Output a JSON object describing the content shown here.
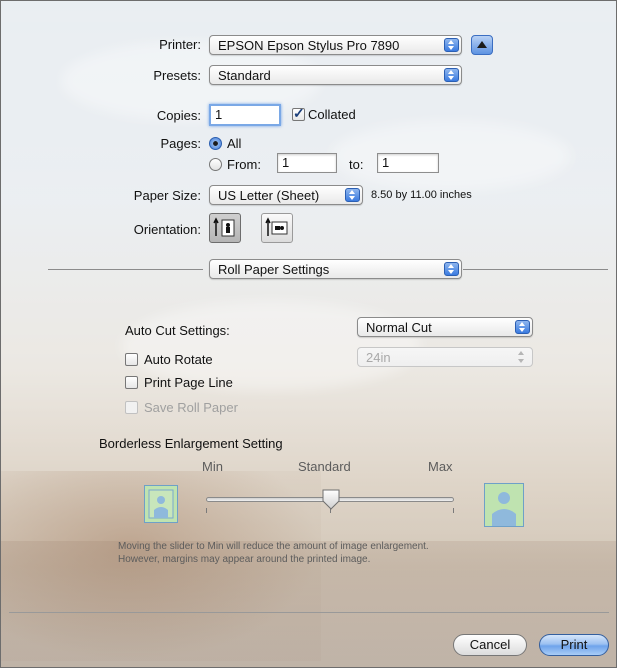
{
  "printer": {
    "label": "Printer:",
    "value": "EPSON Epson Stylus Pro 7890"
  },
  "presets": {
    "label": "Presets:",
    "value": "Standard"
  },
  "copies": {
    "label": "Copies:",
    "value": "1",
    "collated_label": "Collated",
    "collated": true
  },
  "pages": {
    "label": "Pages:",
    "all_label": "All",
    "from_label": "From:",
    "from_value": "1",
    "to_label": "to:",
    "to_value": "1",
    "selected": "All"
  },
  "paper_size": {
    "label": "Paper Size:",
    "value": "US Letter (Sheet)",
    "dimensions": "8.50 by 11.00 inches"
  },
  "orientation": {
    "label": "Orientation:",
    "selected": "portrait"
  },
  "panel_select": {
    "value": "Roll Paper Settings"
  },
  "auto_cut": {
    "label": "Auto Cut Settings:",
    "value": "Normal Cut"
  },
  "options": {
    "auto_rotate": {
      "label": "Auto Rotate",
      "checked": false,
      "enabled": true
    },
    "print_page_line": {
      "label": "Print Page Line",
      "checked": false,
      "enabled": true
    },
    "save_roll_paper": {
      "label": "Save Roll Paper",
      "checked": false,
      "enabled": false
    }
  },
  "roll_width": {
    "value": "24in",
    "enabled": false
  },
  "borderless": {
    "title": "Borderless Enlargement Setting",
    "min_label": "Min",
    "standard_label": "Standard",
    "max_label": "Max",
    "slider_position": "Standard",
    "note_line1": "Moving the slider to Min will reduce the amount of image enlargement.",
    "note_line2": "However, margins may appear around the printed image."
  },
  "buttons": {
    "cancel": "Cancel",
    "print": "Print"
  },
  "colors": {
    "accent": "#3a7be0",
    "default_button": "#6fa3eb",
    "thumbnail_bg": "#bfe3b0"
  }
}
